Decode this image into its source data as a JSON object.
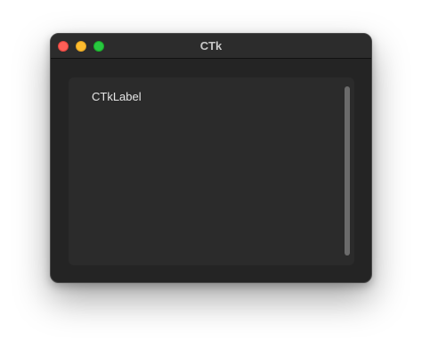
{
  "window": {
    "title": "CTk"
  },
  "content": {
    "label_text": "CTkLabel"
  },
  "icons": {
    "close": "close-button-icon",
    "minimize": "minimize-button-icon",
    "maximize": "zoom-button-icon"
  },
  "colors": {
    "close": "#ff5f57",
    "minimize": "#febc2e",
    "maximize": "#28c840",
    "window_bg": "#242424",
    "frame_bg": "#2b2b2b",
    "scrollbar": "#6b6b6b"
  }
}
